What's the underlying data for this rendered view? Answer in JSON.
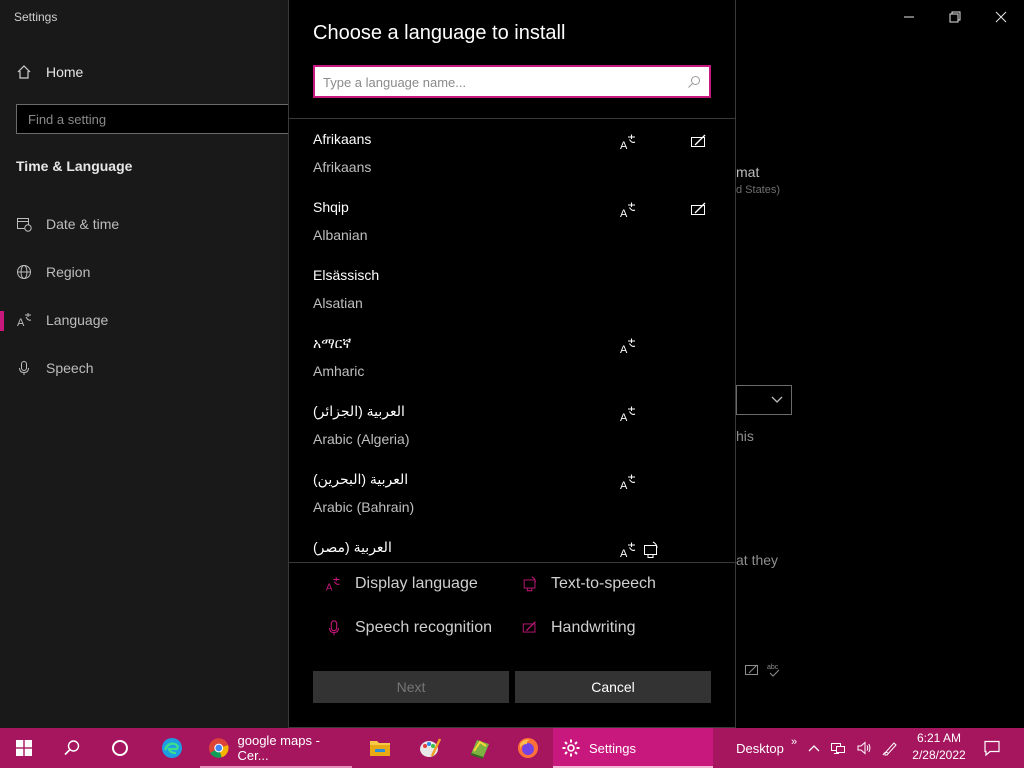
{
  "settings_window": {
    "title": "Settings",
    "home": "Home",
    "search_placeholder": "Find a setting",
    "section": "Time & Language",
    "nav_items": [
      {
        "label": "Date & time",
        "icon": "calendar-clock-icon"
      },
      {
        "label": "Region",
        "icon": "globe-icon"
      },
      {
        "label": "Language",
        "icon": "language-icon"
      },
      {
        "label": "Speech",
        "icon": "microphone-icon"
      }
    ],
    "background_fragments": [
      "mat",
      "d States)",
      "his",
      "at they"
    ]
  },
  "dialog": {
    "title": "Choose a language to install",
    "search_placeholder": "Type a language name...",
    "languages": [
      {
        "native": "Afrikaans",
        "english": "Afrikaans",
        "features": [
          "display-language",
          "handwriting"
        ]
      },
      {
        "native": "Shqip",
        "english": "Albanian",
        "features": [
          "display-language",
          "handwriting"
        ]
      },
      {
        "native": "Elsässisch",
        "english": "Alsatian",
        "features": []
      },
      {
        "native": "አማርኛ",
        "english": "Amharic",
        "features": [
          "display-language"
        ]
      },
      {
        "native": "العربية (الجزائر)",
        "english": "Arabic (Algeria)",
        "features": [
          "display-language"
        ]
      },
      {
        "native": "العربية (البحرين)",
        "english": "Arabic (Bahrain)",
        "features": [
          "display-language"
        ]
      },
      {
        "native": "العربية (مصر)",
        "english": "",
        "features": [
          "display-language",
          "text-to-speech"
        ]
      }
    ],
    "legend": {
      "display_language": "Display language",
      "text_to_speech": "Text-to-speech",
      "speech_recognition": "Speech recognition",
      "handwriting": "Handwriting"
    },
    "buttons": {
      "next": "Next",
      "cancel": "Cancel"
    }
  },
  "taskbar": {
    "apps": [
      {
        "label": "google maps - Cer...",
        "icon": "chrome-icon"
      },
      {
        "label": "Settings",
        "icon": "settings-gear-icon",
        "active": true
      }
    ],
    "desktop_label": "Desktop",
    "time": "6:21 AM",
    "date": "2/28/2022"
  },
  "colors": {
    "accent": "#c8187d",
    "taskbar": "#a5165f"
  }
}
